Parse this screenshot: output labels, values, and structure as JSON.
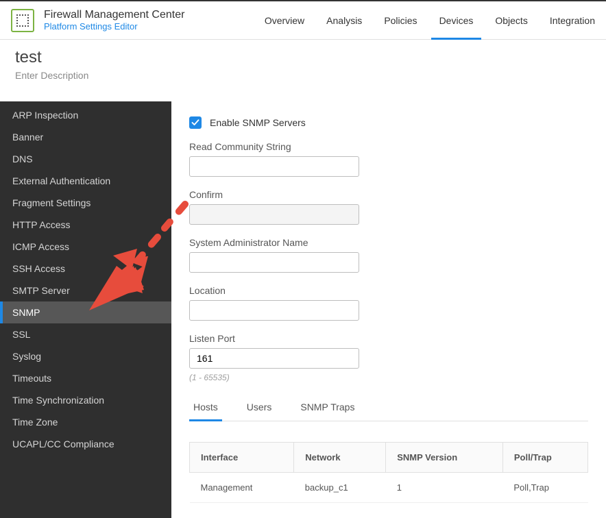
{
  "header": {
    "app_title": "Firewall Management Center",
    "app_subtitle": "Platform Settings Editor",
    "nav": [
      "Overview",
      "Analysis",
      "Policies",
      "Devices",
      "Objects",
      "Integration"
    ],
    "nav_active": 3
  },
  "page": {
    "title": "test",
    "description": "Enter Description"
  },
  "sidebar": {
    "items": [
      "ARP Inspection",
      "Banner",
      "DNS",
      "External Authentication",
      "Fragment Settings",
      "HTTP Access",
      "ICMP Access",
      "SSH Access",
      "SMTP Server",
      "SNMP",
      "SSL",
      "Syslog",
      "Timeouts",
      "Time Synchronization",
      "Time Zone",
      "UCAPL/CC Compliance"
    ],
    "active_index": 9
  },
  "form": {
    "enable_label": "Enable SNMP Servers",
    "enable_checked": true,
    "read_community_label": "Read Community String",
    "read_community_value": "",
    "confirm_label": "Confirm",
    "confirm_value": "",
    "sysadmin_label": "System Administrator Name",
    "sysadmin_value": "",
    "location_label": "Location",
    "location_value": "",
    "listen_port_label": "Listen Port",
    "listen_port_value": "161",
    "listen_port_hint": "(1 - 65535)"
  },
  "tabs": {
    "items": [
      "Hosts",
      "Users",
      "SNMP Traps"
    ],
    "active_index": 0
  },
  "table": {
    "headers": [
      "Interface",
      "Network",
      "SNMP Version",
      "Poll/Trap"
    ],
    "rows": [
      {
        "interface": "Management",
        "network": "backup_c1",
        "snmp_version": "1",
        "poll_trap": "Poll,Trap"
      }
    ]
  }
}
